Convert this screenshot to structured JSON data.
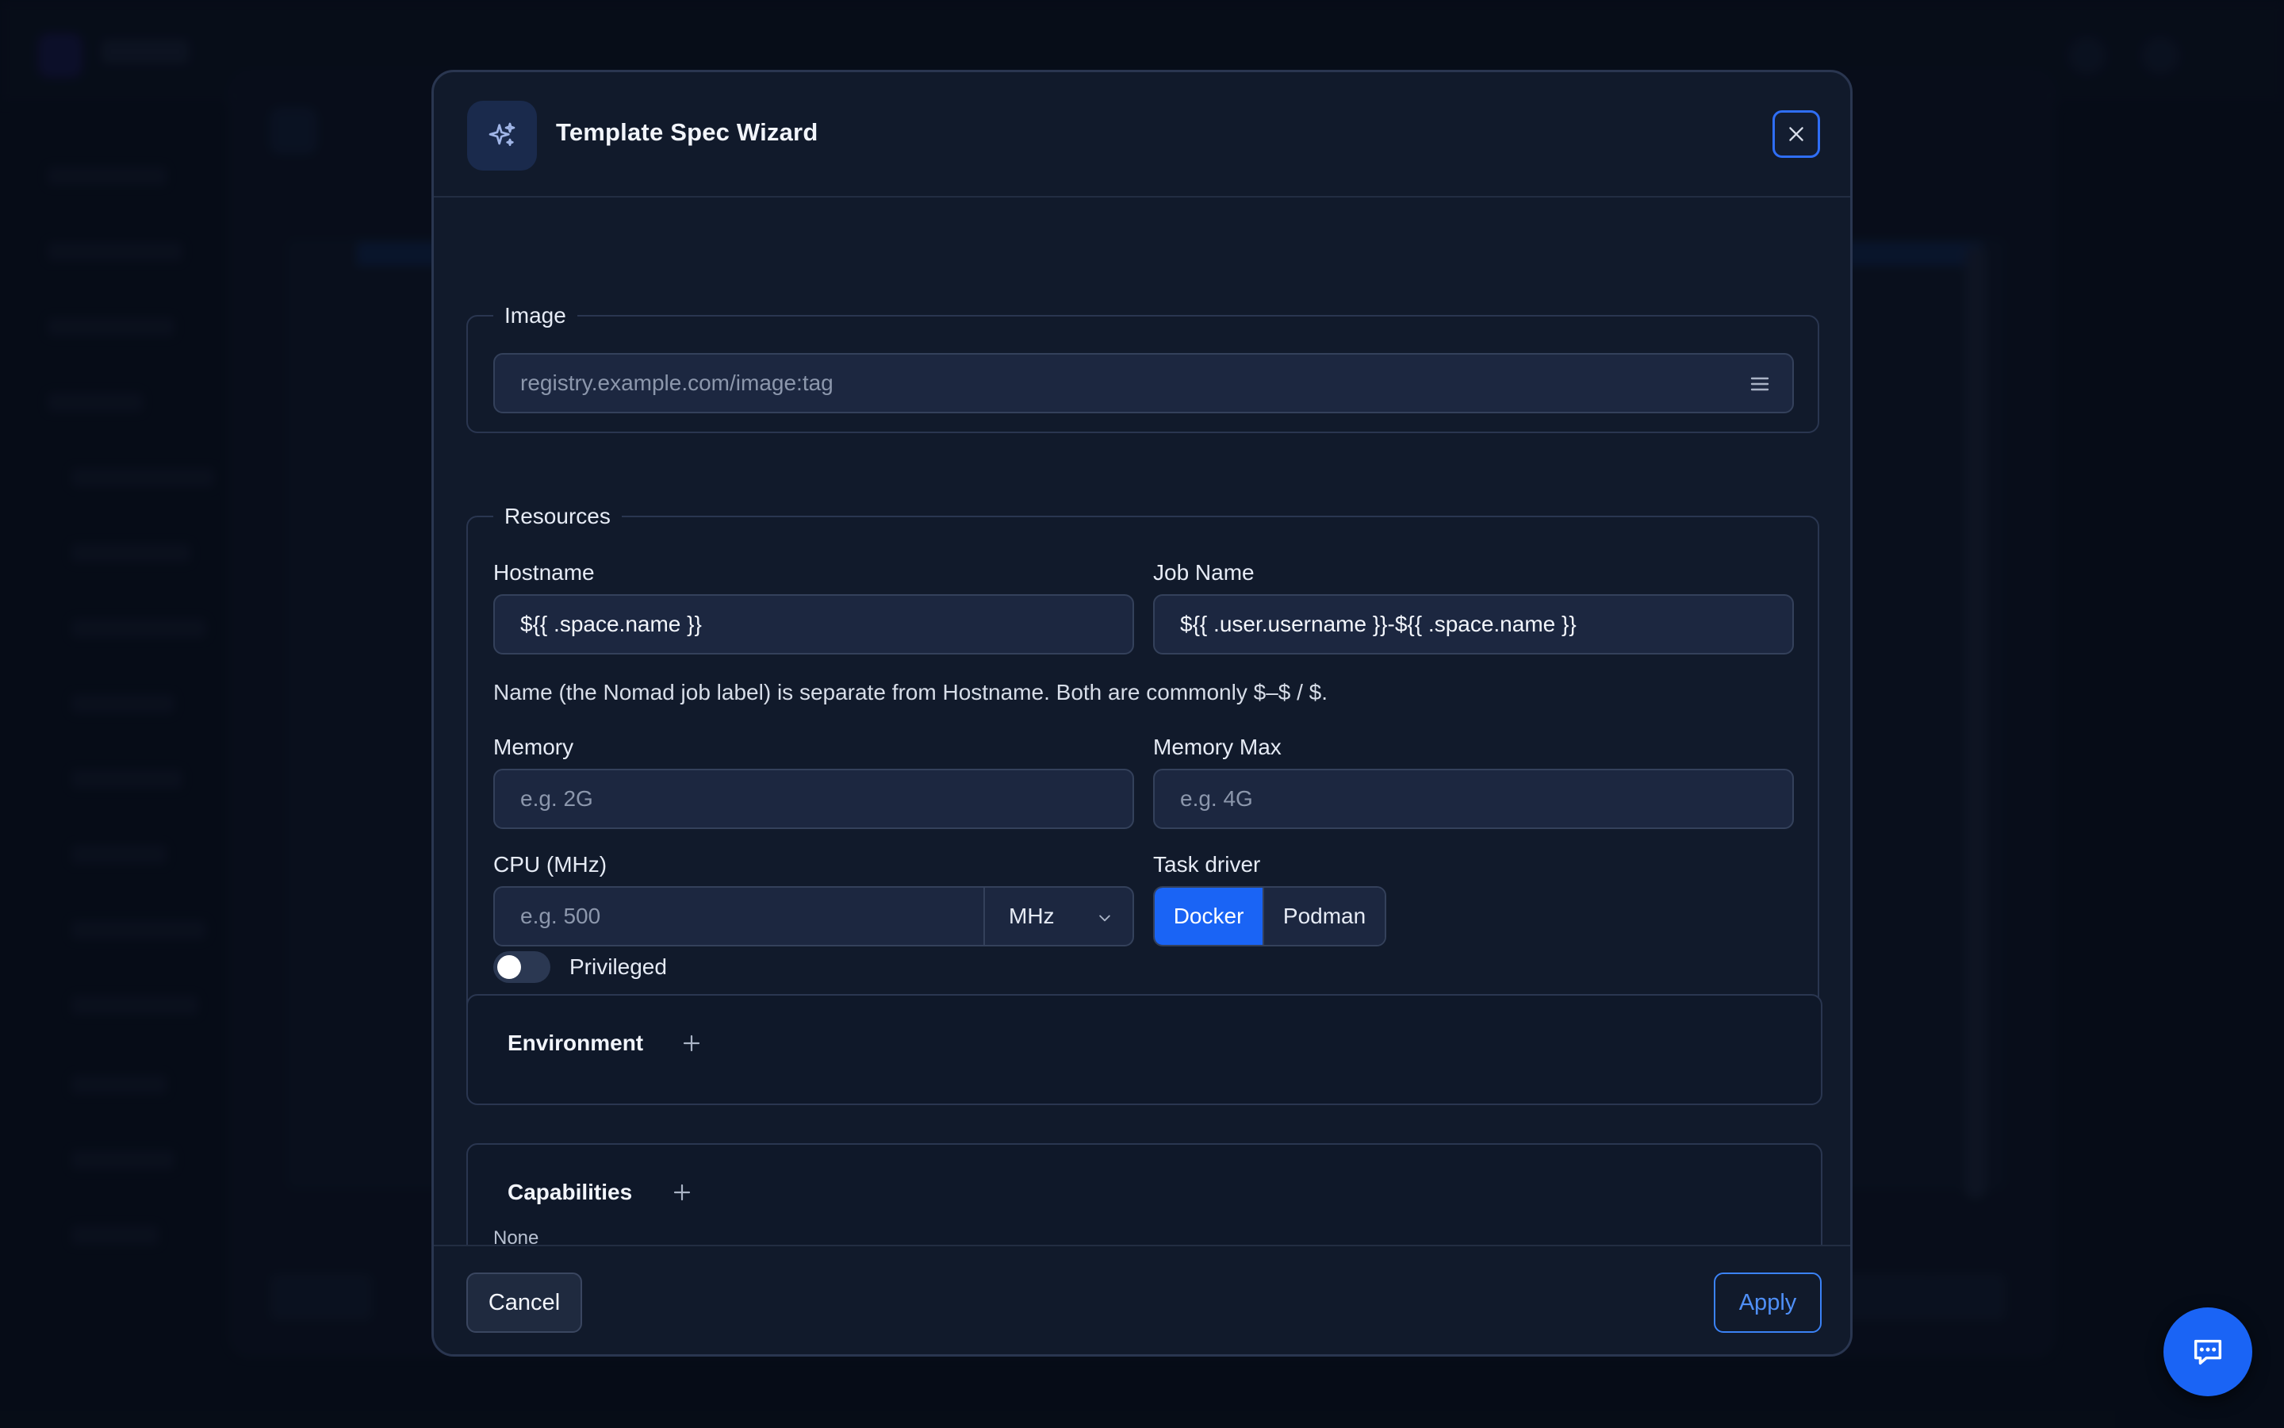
{
  "modal": {
    "title": "Template Spec Wizard",
    "header_icon": "sparkles-icon",
    "close_icon": "close-icon"
  },
  "image_section": {
    "legend": "Image",
    "input_placeholder": "registry.example.com/image:tag",
    "menu_icon": "list-icon"
  },
  "resources": {
    "legend": "Resources",
    "hostname_label": "Hostname",
    "hostname_value": "${{ .space.name }}",
    "jobname_label": "Job Name",
    "jobname_value": "${{ .user.username }}-${{ .space.name }}",
    "hint": "Name (the Nomad job label) is separate from Hostname. Both are commonly $–$ / $.",
    "memory_label": "Memory",
    "memory_placeholder": "e.g. 2G",
    "memory_max_label": "Memory Max",
    "memory_max_placeholder": "e.g. 4G",
    "cpu_label": "CPU (MHz)",
    "cpu_placeholder": "e.g. 500",
    "cpu_unit": "MHz",
    "task_driver_label": "Task driver",
    "task_driver_options": [
      "Docker",
      "Podman"
    ],
    "task_driver_selected": "Docker",
    "privileged_label": "Privileged",
    "privileged_on": false
  },
  "environment": {
    "title": "Environment"
  },
  "capabilities": {
    "title": "Capabilities",
    "value": "None"
  },
  "footer": {
    "cancel_label": "Cancel",
    "apply_label": "Apply"
  },
  "colors": {
    "accent": "#1a64f5",
    "apply_border": "#3b82f6",
    "background": "#0b1220",
    "modal": "#111a2b"
  }
}
